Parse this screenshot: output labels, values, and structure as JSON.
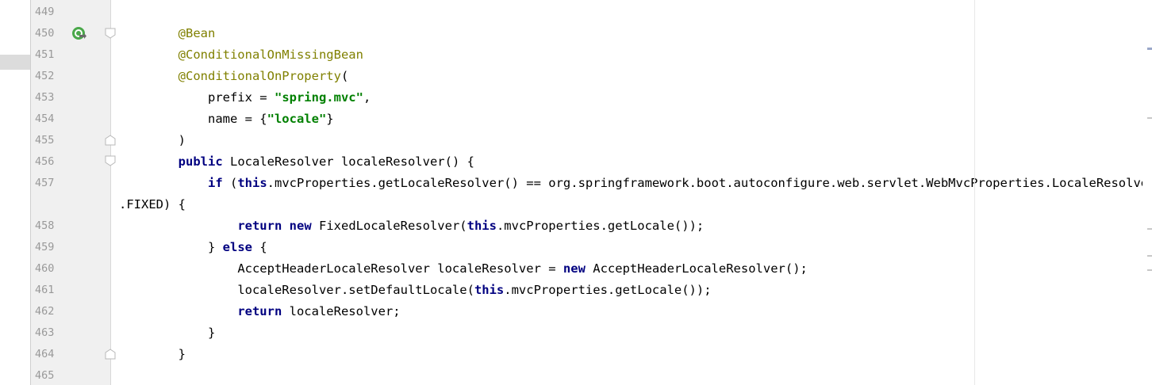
{
  "editor": {
    "lines": [
      {
        "num": "449",
        "tokens": []
      },
      {
        "num": "450",
        "indent": "        ",
        "tokens": [
          {
            "t": "anno",
            "v": "@Bean"
          }
        ]
      },
      {
        "num": "451",
        "indent": "        ",
        "tokens": [
          {
            "t": "anno",
            "v": "@ConditionalOnMissingBean"
          }
        ]
      },
      {
        "num": "452",
        "indent": "        ",
        "tokens": [
          {
            "t": "anno",
            "v": "@ConditionalOnProperty"
          },
          {
            "t": "plain",
            "v": "("
          }
        ]
      },
      {
        "num": "453",
        "indent": "            ",
        "tokens": [
          {
            "t": "plain",
            "v": "prefix = "
          },
          {
            "t": "str",
            "v": "\"spring.mvc\""
          },
          {
            "t": "plain",
            "v": ","
          }
        ]
      },
      {
        "num": "454",
        "indent": "            ",
        "tokens": [
          {
            "t": "plain",
            "v": "name = {"
          },
          {
            "t": "str",
            "v": "\"locale\""
          },
          {
            "t": "plain",
            "v": "}"
          }
        ]
      },
      {
        "num": "455",
        "indent": "        ",
        "tokens": [
          {
            "t": "plain",
            "v": ")"
          }
        ]
      },
      {
        "num": "456",
        "indent": "        ",
        "tokens": [
          {
            "t": "kw",
            "v": "public"
          },
          {
            "t": "plain",
            "v": " LocaleResolver localeResolver() {"
          }
        ]
      },
      {
        "num": "457",
        "indent": "            ",
        "tokens": [
          {
            "t": "kw",
            "v": "if"
          },
          {
            "t": "plain",
            "v": " ("
          },
          {
            "t": "kw",
            "v": "this"
          },
          {
            "t": "plain",
            "v": ".mvcProperties.getLocaleResolver() == org.springframework.boot.autoconfigure.web.servlet.WebMvcProperties.LocaleResolver"
          }
        ]
      },
      {
        "num": "",
        "indent": "",
        "tokens": [
          {
            "t": "plain",
            "v": ".FIXED) {"
          }
        ]
      },
      {
        "num": "458",
        "indent": "                ",
        "tokens": [
          {
            "t": "kw",
            "v": "return"
          },
          {
            "t": "plain",
            "v": " "
          },
          {
            "t": "kw",
            "v": "new"
          },
          {
            "t": "plain",
            "v": " FixedLocaleResolver("
          },
          {
            "t": "kw",
            "v": "this"
          },
          {
            "t": "plain",
            "v": ".mvcProperties.getLocale());"
          }
        ]
      },
      {
        "num": "459",
        "indent": "            ",
        "tokens": [
          {
            "t": "plain",
            "v": "} "
          },
          {
            "t": "kw",
            "v": "else"
          },
          {
            "t": "plain",
            "v": " {"
          }
        ]
      },
      {
        "num": "460",
        "indent": "                ",
        "tokens": [
          {
            "t": "plain",
            "v": "AcceptHeaderLocaleResolver localeResolver = "
          },
          {
            "t": "kw",
            "v": "new"
          },
          {
            "t": "plain",
            "v": " AcceptHeaderLocaleResolver();"
          }
        ]
      },
      {
        "num": "461",
        "indent": "                ",
        "tokens": [
          {
            "t": "plain",
            "v": "localeResolver.setDefaultLocale("
          },
          {
            "t": "kw",
            "v": "this"
          },
          {
            "t": "plain",
            "v": ".mvcProperties.getLocale());"
          }
        ]
      },
      {
        "num": "462",
        "indent": "                ",
        "tokens": [
          {
            "t": "kw",
            "v": "return"
          },
          {
            "t": "plain",
            "v": " localeResolver;"
          }
        ]
      },
      {
        "num": "463",
        "indent": "            ",
        "tokens": [
          {
            "t": "plain",
            "v": "}"
          }
        ]
      },
      {
        "num": "464",
        "indent": "        ",
        "tokens": [
          {
            "t": "plain",
            "v": "}"
          }
        ]
      },
      {
        "num": "465",
        "tokens": []
      }
    ],
    "icons": {
      "run_gutter": "bean-navigate-icon",
      "fold": "fold-marker-icon"
    }
  },
  "colors": {
    "keyword": "#000080",
    "string": "#008000",
    "annotation": "#808000",
    "gutter_bg": "#f0f0f0",
    "line_number": "#999999"
  }
}
